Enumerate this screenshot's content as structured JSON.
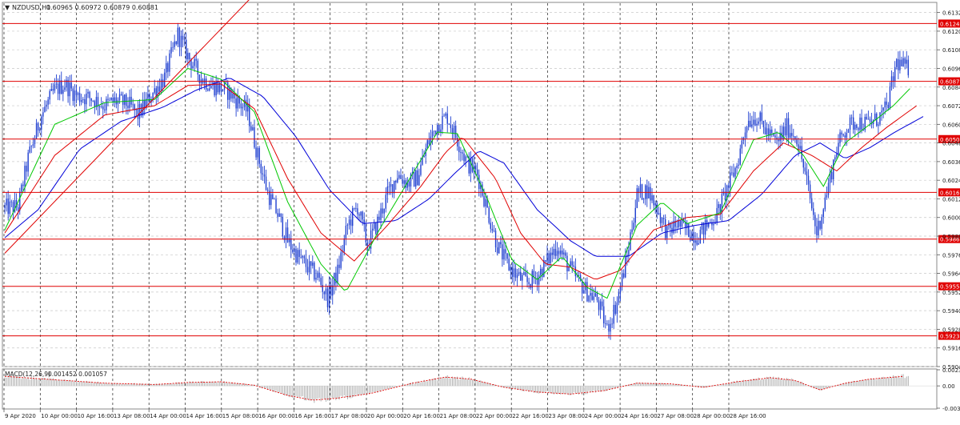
{
  "symbol_header": {
    "menu_glyph": "▼",
    "title": "NZDUSD,H1",
    "ohlc": "0.60965 0.60972 0.60879 0.60881"
  },
  "macd_header": {
    "title": "MACD(12,26,9)",
    "values": "0.001452 0.001057"
  },
  "colors": {
    "background": "#ffffff",
    "candle": "#1f3fd0",
    "ma_fast": "#00c800",
    "ma_mid": "#e00000",
    "ma_slow": "#0000d8",
    "hline": "#e00000",
    "grid": "#c8c8c8",
    "vgrid": "#202020",
    "macd_hist": "#a8a8a8",
    "macd_signal": "#e00000"
  },
  "chart_data": {
    "type": "candlestick",
    "symbol": "NZDUSD",
    "timeframe": "H1",
    "ylim": [
      0.5904,
      0.6138
    ],
    "y_ticks": [
      "0.61320",
      "0.61200",
      "0.61080",
      "0.60960",
      "0.60840",
      "0.60720",
      "0.60600",
      "0.60480",
      "0.60360",
      "0.60240",
      "0.60120",
      "0.60000",
      "0.59880",
      "0.59760",
      "0.59640",
      "0.59520",
      "0.59400",
      "0.59280",
      "0.59160",
      "0.59040"
    ],
    "x_ticks": [
      "9 Apr 2020",
      "10 Apr 00:00",
      "10 Apr 16:00",
      "13 Apr 08:00",
      "14 Apr 00:00",
      "14 Apr 16:00",
      "15 Apr 08:00",
      "16 Apr 00:00",
      "16 Apr 16:00",
      "17 Apr 08:00",
      "20 Apr 00:00",
      "20 Apr 16:00",
      "21 Apr 08:00",
      "22 Apr 00:00",
      "22 Apr 16:00",
      "23 Apr 08:00",
      "24 Apr 00:00",
      "24 Apr 16:00",
      "27 Apr 08:00",
      "28 Apr 00:00",
      "28 Apr 16:00"
    ],
    "price_levels": [
      "0.61249",
      "0.60877",
      "0.60505",
      "0.60162",
      "0.59861",
      "0.59557",
      "0.59238"
    ],
    "close_path": [
      [
        0,
        0.6006
      ],
      [
        8,
        0.6007
      ],
      [
        14,
        0.6038
      ],
      [
        22,
        0.6066
      ],
      [
        30,
        0.6082
      ],
      [
        36,
        0.6086
      ],
      [
        44,
        0.6078
      ],
      [
        52,
        0.6077
      ],
      [
        60,
        0.6072
      ],
      [
        66,
        0.6075
      ],
      [
        74,
        0.6073
      ],
      [
        80,
        0.6066
      ],
      [
        88,
        0.6079
      ],
      [
        96,
        0.609
      ],
      [
        104,
        0.6118
      ],
      [
        110,
        0.6104
      ],
      [
        118,
        0.609
      ],
      [
        124,
        0.6085
      ],
      [
        132,
        0.6083
      ],
      [
        138,
        0.6077
      ],
      [
        146,
        0.6068
      ],
      [
        152,
        0.604
      ],
      [
        158,
        0.6016
      ],
      [
        164,
        0.6002
      ],
      [
        170,
        0.5985
      ],
      [
        176,
        0.5975
      ],
      [
        182,
        0.5968
      ],
      [
        188,
        0.5962
      ],
      [
        194,
        0.5948
      ],
      [
        200,
        0.5965
      ],
      [
        206,
        0.5995
      ],
      [
        212,
        0.6007
      ],
      [
        218,
        0.5982
      ],
      [
        224,
        0.5997
      ],
      [
        230,
        0.6015
      ],
      [
        236,
        0.6028
      ],
      [
        242,
        0.6022
      ],
      [
        248,
        0.6026
      ],
      [
        254,
        0.6047
      ],
      [
        260,
        0.606
      ],
      [
        266,
        0.6065
      ],
      [
        272,
        0.605
      ],
      [
        278,
        0.6035
      ],
      [
        284,
        0.6028
      ],
      [
        290,
        0.6005
      ],
      [
        296,
        0.5982
      ],
      [
        302,
        0.597
      ],
      [
        308,
        0.5962
      ],
      [
        314,
        0.5958
      ],
      [
        320,
        0.5962
      ],
      [
        326,
        0.5972
      ],
      [
        332,
        0.5982
      ],
      [
        338,
        0.597
      ],
      [
        344,
        0.596
      ],
      [
        350,
        0.5952
      ],
      [
        356,
        0.5947
      ],
      [
        362,
        0.5928
      ],
      [
        368,
        0.5946
      ],
      [
        374,
        0.5975
      ],
      [
        380,
        0.6015
      ],
      [
        386,
        0.6018
      ],
      [
        392,
        0.6006
      ],
      [
        398,
        0.599
      ],
      [
        404,
        0.5996
      ],
      [
        410,
        0.5992
      ],
      [
        416,
        0.5988
      ],
      [
        422,
        0.5995
      ],
      [
        428,
        0.6002
      ],
      [
        434,
        0.6018
      ],
      [
        440,
        0.6034
      ],
      [
        446,
        0.6062
      ],
      [
        452,
        0.6065
      ],
      [
        458,
        0.6055
      ],
      [
        464,
        0.6048
      ],
      [
        470,
        0.6058
      ],
      [
        476,
        0.6052
      ],
      [
        482,
        0.6023
      ],
      [
        488,
        0.599
      ],
      [
        494,
        0.6016
      ],
      [
        500,
        0.6045
      ],
      [
        506,
        0.6058
      ],
      [
        512,
        0.6062
      ],
      [
        518,
        0.606
      ],
      [
        524,
        0.6063
      ],
      [
        530,
        0.607
      ],
      [
        536,
        0.61
      ],
      [
        542,
        0.6096
      ]
    ],
    "ma_fast": [
      [
        0,
        0.5992
      ],
      [
        30,
        0.606
      ],
      [
        60,
        0.6074
      ],
      [
        90,
        0.6076
      ],
      [
        110,
        0.6096
      ],
      [
        130,
        0.6089
      ],
      [
        150,
        0.6068
      ],
      [
        170,
        0.601
      ],
      [
        190,
        0.597
      ],
      [
        205,
        0.5952
      ],
      [
        225,
        0.5992
      ],
      [
        245,
        0.6028
      ],
      [
        260,
        0.6055
      ],
      [
        272,
        0.6054
      ],
      [
        290,
        0.6012
      ],
      [
        305,
        0.5972
      ],
      [
        320,
        0.596
      ],
      [
        335,
        0.5975
      ],
      [
        350,
        0.5955
      ],
      [
        362,
        0.5948
      ],
      [
        380,
        0.5995
      ],
      [
        395,
        0.601
      ],
      [
        410,
        0.5996
      ],
      [
        430,
        0.6003
      ],
      [
        450,
        0.605
      ],
      [
        465,
        0.6055
      ],
      [
        480,
        0.604
      ],
      [
        492,
        0.602
      ],
      [
        505,
        0.6048
      ],
      [
        520,
        0.606
      ],
      [
        534,
        0.6072
      ],
      [
        544,
        0.6083
      ]
    ],
    "ma_mid": [
      [
        0,
        0.599
      ],
      [
        30,
        0.604
      ],
      [
        60,
        0.6066
      ],
      [
        90,
        0.6072
      ],
      [
        110,
        0.6085
      ],
      [
        130,
        0.6086
      ],
      [
        150,
        0.607
      ],
      [
        170,
        0.6025
      ],
      [
        190,
        0.599
      ],
      [
        210,
        0.5972
      ],
      [
        230,
        0.5995
      ],
      [
        250,
        0.602
      ],
      [
        265,
        0.6042
      ],
      [
        275,
        0.6052
      ],
      [
        295,
        0.6025
      ],
      [
        310,
        0.599
      ],
      [
        325,
        0.597
      ],
      [
        340,
        0.5968
      ],
      [
        355,
        0.596
      ],
      [
        370,
        0.5966
      ],
      [
        390,
        0.5992
      ],
      [
        410,
        0.6
      ],
      [
        430,
        0.6002
      ],
      [
        450,
        0.603
      ],
      [
        468,
        0.6048
      ],
      [
        485,
        0.604
      ],
      [
        500,
        0.603
      ],
      [
        515,
        0.6045
      ],
      [
        530,
        0.6058
      ],
      [
        548,
        0.6072
      ]
    ],
    "ma_slow": [
      [
        0,
        0.5987
      ],
      [
        20,
        0.6005
      ],
      [
        45,
        0.6044
      ],
      [
        70,
        0.6062
      ],
      [
        95,
        0.6071
      ],
      [
        115,
        0.6082
      ],
      [
        135,
        0.609
      ],
      [
        155,
        0.6078
      ],
      [
        175,
        0.6052
      ],
      [
        195,
        0.6018
      ],
      [
        215,
        0.5996
      ],
      [
        235,
        0.5998
      ],
      [
        255,
        0.6012
      ],
      [
        270,
        0.6028
      ],
      [
        285,
        0.6043
      ],
      [
        300,
        0.6035
      ],
      [
        320,
        0.6005
      ],
      [
        340,
        0.5985
      ],
      [
        355,
        0.5975
      ],
      [
        375,
        0.5975
      ],
      [
        395,
        0.599
      ],
      [
        415,
        0.5995
      ],
      [
        435,
        0.5998
      ],
      [
        455,
        0.6015
      ],
      [
        475,
        0.604
      ],
      [
        490,
        0.6048
      ],
      [
        505,
        0.6038
      ],
      [
        520,
        0.6045
      ],
      [
        535,
        0.6055
      ],
      [
        552,
        0.6065
      ]
    ],
    "trendline": [
      [
        0,
        0.5977
      ],
      [
        152,
        0.6146
      ]
    ],
    "macd": {
      "ylim": [
        -0.00328,
        0.00237
      ],
      "y_ticks": [
        "0.00237",
        "0.00",
        "-0.00328"
      ],
      "signal": [
        [
          0,
          0.0014
        ],
        [
          30,
          0.0009
        ],
        [
          60,
          0.0004
        ],
        [
          90,
          0.0002
        ],
        [
          110,
          0.0005
        ],
        [
          130,
          0.0006
        ],
        [
          150,
          0.0001
        ],
        [
          170,
          -0.0014
        ],
        [
          185,
          -0.0021
        ],
        [
          200,
          -0.0018
        ],
        [
          220,
          -0.0011
        ],
        [
          245,
          0.0004
        ],
        [
          265,
          0.0013
        ],
        [
          280,
          0.001
        ],
        [
          300,
          -0.0002
        ],
        [
          320,
          -0.0009
        ],
        [
          340,
          -0.0012
        ],
        [
          360,
          -0.0007
        ],
        [
          380,
          0.0004
        ],
        [
          400,
          0.0003
        ],
        [
          420,
          -0.0002
        ],
        [
          440,
          0.0006
        ],
        [
          460,
          0.0012
        ],
        [
          475,
          0.0008
        ],
        [
          490,
          -0.0006
        ],
        [
          505,
          0.0004
        ],
        [
          520,
          0.001
        ],
        [
          540,
          0.0014
        ]
      ]
    }
  }
}
